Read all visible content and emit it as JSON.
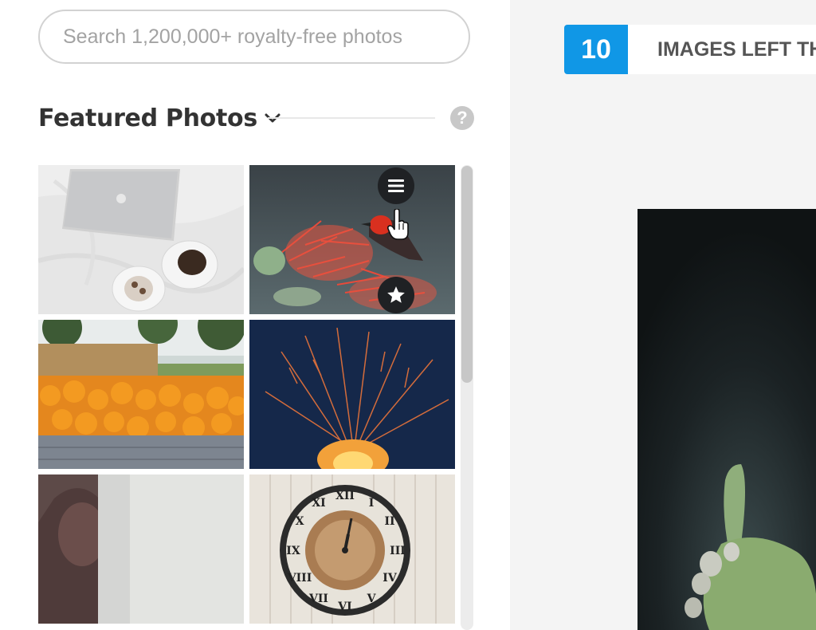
{
  "search": {
    "placeholder": "Search 1,200,000+ royalty-free photos"
  },
  "featured": {
    "title": "Featured Photos",
    "help_symbol": "?"
  },
  "photos": [
    {
      "subject": "laptop and coffee on bed sheets"
    },
    {
      "subject": "red bird on red flowers"
    },
    {
      "subject": "pumpkins in wooden crates"
    },
    {
      "subject": "sparks from fire at night"
    },
    {
      "subject": "woman behind frosted glass"
    },
    {
      "subject": "roman numeral wall clock"
    }
  ],
  "photo_actions": {
    "menu_icon": "hamburger-menu-icon",
    "favorite_icon": "star-icon"
  },
  "counter": {
    "value": "10",
    "label": "IMAGES LEFT TH"
  },
  "colors": {
    "accent": "#1097e6",
    "border": "#d2d2d2",
    "right_bg": "#f4f4f4",
    "button_dark": "#1f2124"
  }
}
